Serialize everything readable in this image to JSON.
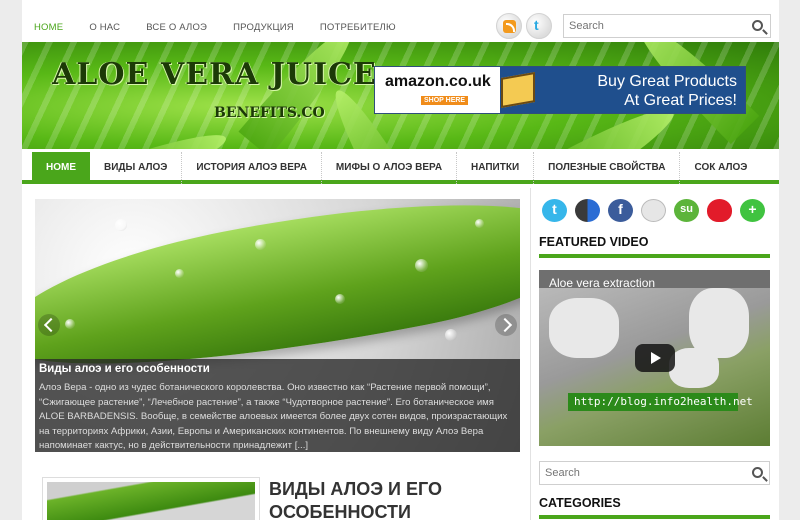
{
  "topnav": {
    "items": [
      "HOME",
      "О НАС",
      "ВСЕ О АЛОЭ",
      "ПРОДУКЦИЯ",
      "ПОТРЕБИТЕЛЮ"
    ]
  },
  "top_search": {
    "placeholder": "Search"
  },
  "header": {
    "logo_title": "ALOE VERA JUICE",
    "logo_sub": "BENEFITS.CO",
    "ad": {
      "brand": "amazon.co.uk",
      "shop": "SHOP HERE",
      "line1": "Buy Great Products",
      "line2": "At Great Prices!"
    }
  },
  "mainnav": {
    "items": [
      "HOME",
      "ВИДЫ АЛОЭ",
      "ИСТОРИЯ АЛОЭ ВЕРА",
      "МИФЫ О АЛОЭ ВЕРА",
      "НАПИТКИ",
      "ПОЛЕЗНЫЕ СВОЙСТВА",
      "СОК АЛОЭ"
    ]
  },
  "slider": {
    "title": "Виды алоэ и его особенности",
    "text": "Алоэ Вера - одно из чудес ботанического королевства. Оно известно как “Растение первой помощи”, “Сжигающее растение”, “Лечебное растение”, а также “Чудотворное растение”. Его ботаническое имя ALOE BARBADENSIS. Вообще, в семействе алоевых имеется более двух сотен видов, произрастающих на территориях Африки, Азии, Европы и Американских континентов. По внешнему виду Алоэ Вера напоминает кактус, но в действительности принадлежит [...]"
  },
  "post": {
    "title_line1": "ВИДЫ АЛОЭ И ЕГО",
    "title_line2": "ОСОБЕННОСТИ"
  },
  "sidebar": {
    "featured_video_title": "FEATURED VIDEO",
    "video": {
      "title": "Aloe vera extraction",
      "url_text": "http://blog.info2health.net"
    },
    "search_placeholder": "Search",
    "categories_title": "CATEGORIES"
  },
  "colors": {
    "accent": "#4aa61b",
    "caption_bg": "#282828"
  }
}
